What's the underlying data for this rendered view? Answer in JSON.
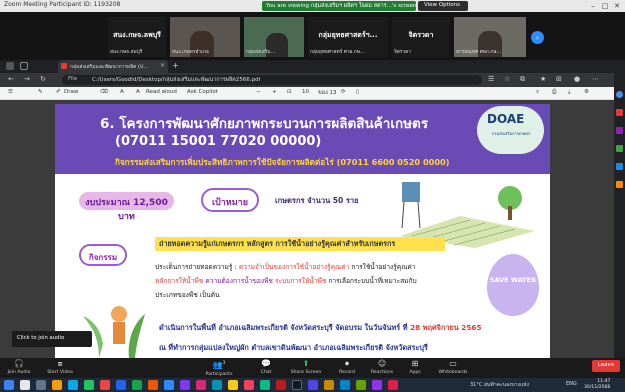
{
  "zoom": {
    "window_title": "Zoom Meeting Participant ID: 1193208",
    "share_banner": "You are viewing กลุ่มส่งเสริมฯ ผลิตฯ ใจดม สตาร...'s screen",
    "view_options": "View Options",
    "tiles": [
      {
        "name": "สนง.กษจ.ลพบุรี",
        "label": "สนง.กษจ.ลพบุรี"
      },
      {
        "name": "",
        "label": "สนง.เกษตรอำเภอ"
      },
      {
        "name": "",
        "label": "กลุ่มส่งเสริม..."
      },
      {
        "name": "กลุ่มยุทธศาสตร์ฯ...",
        "label": "กลุ่มยุทธศาสตร์ ศวอ.กษ..."
      },
      {
        "name": "จิตรวดา",
        "label": "จิตรวดา"
      },
      {
        "name": "",
        "label": "สารสนเทศ ศพก.กษ..."
      }
    ],
    "audio_tip": "Click to join audio",
    "toolbar": [
      {
        "icon": "headphones-icon",
        "label": "Join Audio"
      },
      {
        "icon": "video-icon",
        "label": "Start Video"
      },
      {
        "icon": "participants-icon",
        "label": "Participants"
      },
      {
        "icon": "chat-icon",
        "label": "Chat"
      },
      {
        "icon": "share-screen-icon",
        "label": "Share Screen"
      },
      {
        "icon": "record-icon",
        "label": "Record"
      },
      {
        "icon": "reactions-icon",
        "label": "Reactions"
      },
      {
        "icon": "apps-icon",
        "label": "Apps"
      },
      {
        "icon": "whiteboards-icon",
        "label": "Whiteboards"
      }
    ],
    "participants_count": "3",
    "leave_label": "Leave"
  },
  "browser": {
    "tab_title": "กลุ่มส่งเสริมและพัฒนาการผลิต (ป...",
    "file_label": "File",
    "url": "C:/Users/GoodId/Desktop/กลุ่มส่งเสริมและพัฒนาการผลิต2566.pdf",
    "pdf_toolbar": {
      "draw": "Draw",
      "read_aloud": "Read aloud",
      "ask_copilot": "Ask Copilot",
      "zoom_minus": "−",
      "zoom_plus": "+",
      "page_current": "10",
      "page_total": "ของ 13"
    }
  },
  "pdf": {
    "title_line1": "6. โครงการพัฒนาศักยภาพกระบวนการผลิตสินค้าเกษตร",
    "title_line2": "(07011 15001 77020 00000)",
    "title_line3": "กิจกรรมส่งเสริมการเพิ่มประสิทธิภาพการใช้ปัจจัยการผลิตต่อไร่ (07011 6600 0520 0000)",
    "logo": "DOAE",
    "logo_sub": "กรมส่งเสริมการเกษตร",
    "budget": "งบประมาณ 12,500 บาท",
    "target_label": "เป้าหมาย",
    "target_text": "เกษตรกร จำนวน 50 ราย",
    "activity_label": "กิจกรรม",
    "activity_highlight": "ถ่ายทอดความรู้แก่เกษตรกร หลักสูตร การใช้น้ำอย่างรู้คุณค่าสำหรับเกษตรกร",
    "body": {
      "line1_a": "ประเด็นการถ่ายทอดความรู้ :",
      "line1_b": "ความจำเป็นของการใช้น้ำอย่างรู้คุณค่า",
      "line1_c": "การใช้น้ำอย่างรู้คุณค่า",
      "line2_a": "หลักการให้น้ำพืช",
      "line2_b": "ความต้องการน้ำของพืช",
      "line2_c": "ระบบการให้น้ำพืช",
      "line2_d": "การเลือกระบบน้ำที่เหมาะสมกับ",
      "line3": "ประเภทของพืช เป็นต้น"
    },
    "location_line1_a": "ดำเนินการในพื้นที่ อำเภอเฉลิมพระเกียรติ จังหวัดสระบุรี จัดอบรม ในวันจันทร์ ที่",
    "location_line1_b": "28 พฤศจิกายน 2565",
    "location_line2": "ณ ที่ทำการกลุ่มแปลงใหญ่ผัก ตำบลเขาดินพัฒนา อำเภอเฉลิมพระเกียรติ จังหวัดสระบุรี",
    "save_water": "SAVE WATER"
  },
  "taskbar": {
    "weather": "31°C ฝนฟ้าคะนองบางแห่ง",
    "lang": "ENG",
    "time": "11:47",
    "date": "30/11/2566"
  }
}
